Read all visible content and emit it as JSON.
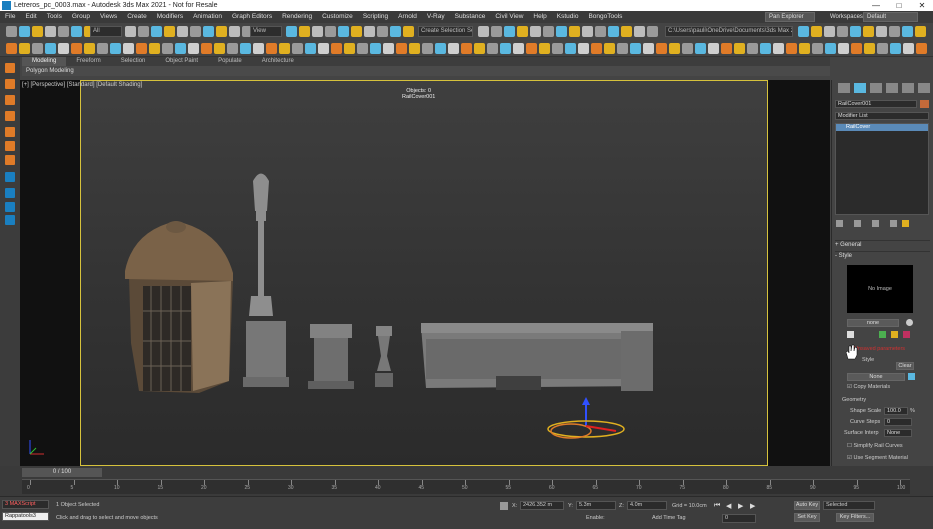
{
  "window": {
    "title": "Letreros_pc_0003.max - Autodesk 3ds Max 2021 - Not for Resale",
    "minimize": "—",
    "maximize": "□",
    "close": "✕"
  },
  "menu": {
    "items": [
      "File",
      "Edit",
      "Tools",
      "Group",
      "Views",
      "Create",
      "Modifiers",
      "Animation",
      "Graph Editors",
      "Rendering",
      "Customize",
      "Scripting",
      "Arnold",
      "V-Ray",
      "Substance",
      "Civil View",
      "Help",
      "Kstudio",
      "BongoTools"
    ],
    "scene_explorer": "Pan Explorer",
    "workspace_label": "Workspaces:",
    "workspace_value": "Default"
  },
  "toolbar": {
    "selection_filter": "All",
    "view_dropdown": "View",
    "selection_set": "Create Selection Se",
    "project_path": "C:\\Users\\pauli\\OneDrive\\Documents\\3ds Max 2021"
  },
  "ribbon": {
    "tabs": [
      "Modeling",
      "Freeform",
      "Selection",
      "Object Paint",
      "Populate",
      "Architecture"
    ],
    "active_tab": 0,
    "sub_label": "Polygon Modeling"
  },
  "viewport": {
    "label": "[+] [Perspective] [Standard] [Default Shading]",
    "object_label_line1": "Objects: 0",
    "object_label_line2": "RailCover001"
  },
  "command_panel": {
    "object_name": "RailCover001",
    "modifier_list": "Modifier List",
    "stack_item": "RailCover",
    "rollout_general": "General",
    "rollout_style": "Style",
    "preview_text": "No Image",
    "name_button": "none",
    "warning_text": "Unsaved parameters",
    "style_label": "Style",
    "clear_button": "Clear",
    "none_button": "None",
    "copy_materials": "Copy Materials",
    "geometry_label": "Geometry",
    "shape_scale_label": "Shape Scale",
    "shape_scale_value": "100.0",
    "shape_scale_unit": "%",
    "curve_steps_label": "Curve Steps",
    "curve_steps_value": "0",
    "surface_interp_label": "Surface Interp",
    "surface_interp_value": "None",
    "simplify_label": "Simplify Rail Curves",
    "use_segment_label": "Use Segment Material"
  },
  "timeline": {
    "time_slider": "0 / 100",
    "ticks": [
      "0",
      "5",
      "10",
      "15",
      "20",
      "25",
      "30",
      "35",
      "40",
      "45",
      "50",
      "55",
      "60",
      "65",
      "70",
      "75",
      "80",
      "85",
      "90",
      "95",
      "100"
    ]
  },
  "status": {
    "max_script_label": "3 MAXScript",
    "mini_listener": "Rappatools3",
    "selected_text": "1 Object Selected",
    "prompt_text": "Click and drag to select and move objects",
    "x_value": "2426.352 m",
    "y_value": "5.3m",
    "z_value": "4.0m",
    "grid_value": "Grid = 10.0cm",
    "isolate": "Enable:",
    "add_time_tag": "Add Time Tag",
    "auto_key": "Auto Key",
    "set_key": "Set Key",
    "selected_dropdown": "Selected",
    "key_filters": "Key Filters...",
    "frame_value": "0"
  },
  "colors": {
    "accent_yellow": "#d6c23c",
    "brand_blue": "#1a7fc0",
    "orange": "#e07b28",
    "warning_red": "#d23030"
  }
}
